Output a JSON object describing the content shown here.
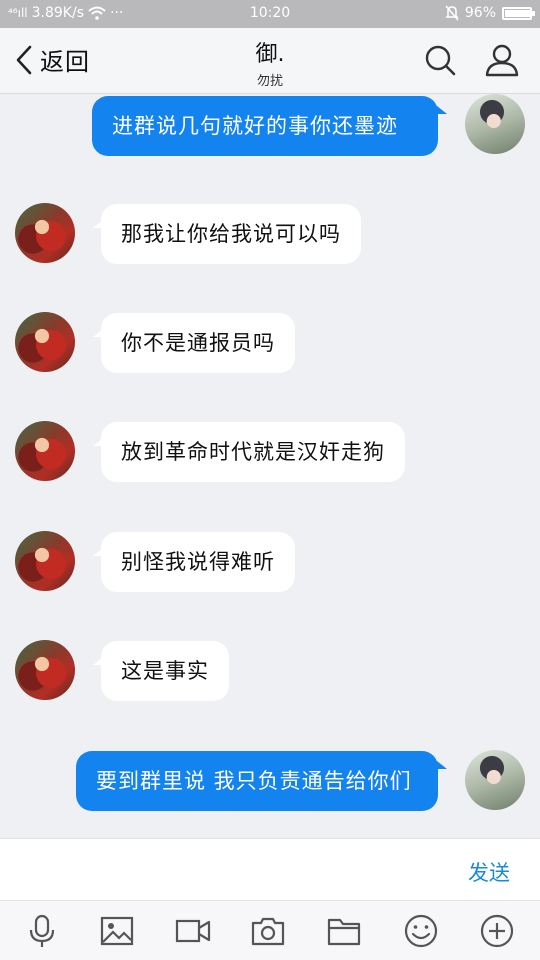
{
  "status_bar": {
    "signal_text": "⁴⁶ıll",
    "speed": "3.89K/s",
    "more": "···",
    "time": "10:20",
    "battery": "96%",
    "battery_level": 0.96
  },
  "header": {
    "back_label": "返回",
    "title": "御.",
    "subtitle": "勿扰"
  },
  "messages": [
    {
      "side": "right",
      "text": "进群说几句就好的事你还墨迹"
    },
    {
      "side": "left",
      "text": "那我让你给我说可以吗"
    },
    {
      "side": "left",
      "text": "你不是通报员吗"
    },
    {
      "side": "left",
      "text": "放到革命时代就是汉奸走狗"
    },
    {
      "side": "left",
      "text": "别怪我说得难听"
    },
    {
      "side": "left",
      "text": "这是事实"
    },
    {
      "side": "right",
      "text": "要到群里说 我只负责通告给你们"
    }
  ],
  "input": {
    "send_label": "发送"
  },
  "toolbar": {
    "icons": [
      "microphone-icon",
      "image-icon",
      "video-icon",
      "camera-icon",
      "folder-icon",
      "emoji-icon",
      "plus-icon"
    ]
  },
  "colors": {
    "accent": "#1383f0",
    "send_text": "#1a8ad8",
    "background": "#eff0f4"
  }
}
